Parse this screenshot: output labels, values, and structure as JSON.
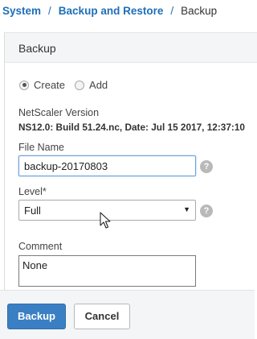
{
  "breadcrumb": {
    "items": [
      "System",
      "Backup and Restore"
    ],
    "separator": "/",
    "current": "Backup"
  },
  "panel": {
    "title": "Backup",
    "radio": {
      "options": [
        "Create",
        "Add"
      ],
      "selected": "Create"
    },
    "version": {
      "label": "NetScaler Version",
      "value": "NS12.0: Build 51.24.nc, Date: Jul 15 2017, 12:37:10"
    },
    "file_name": {
      "label": "File Name",
      "value": "backup-20170803",
      "help": "?"
    },
    "level": {
      "label": "Level*",
      "value": "Full",
      "help": "?"
    },
    "comment": {
      "label": "Comment",
      "value": "None"
    }
  },
  "footer": {
    "primary_label": "Backup",
    "cancel_label": "Cancel"
  },
  "colors": {
    "link": "#1d6fb8",
    "primary_button": "#3a7fc4",
    "header_bg": "#f4f5f7"
  },
  "icons": {
    "help": "help-icon",
    "dropdown": "chevron-down-icon",
    "cursor": "mouse-pointer-icon"
  }
}
